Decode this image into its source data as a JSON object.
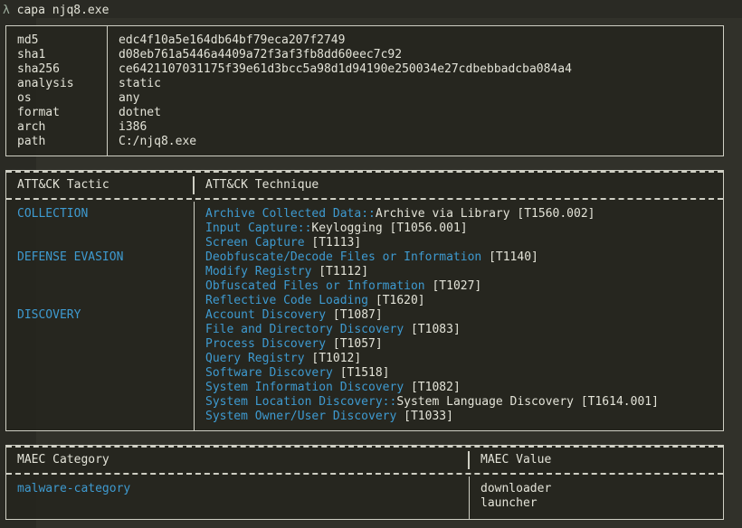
{
  "prompt": {
    "symbol": "λ",
    "command": "capa njq8.exe"
  },
  "info": {
    "rows": [
      {
        "key": "md5",
        "value": "edc4f10a5e164db64bf79eca207f2749"
      },
      {
        "key": "sha1",
        "value": "d08eb761a5446a4409a72f3af3fb8dd60eec7c92"
      },
      {
        "key": "sha256",
        "value": "ce6421107031175f39e61d3bcc5a98d1d94190e250034e27cdbebbadcba084a4"
      },
      {
        "key": "analysis",
        "value": "static"
      },
      {
        "key": "os",
        "value": "any"
      },
      {
        "key": "format",
        "value": "dotnet"
      },
      {
        "key": "arch",
        "value": "i386"
      },
      {
        "key": "path",
        "value": "C:/njq8.exe"
      }
    ]
  },
  "attack": {
    "header_tactic": "ATT&CK Tactic",
    "header_technique": "ATT&CK Technique",
    "tactics": [
      {
        "name": "COLLECTION",
        "row": 0
      },
      {
        "name": "DEFENSE EVASION",
        "row": 3
      },
      {
        "name": "DISCOVERY",
        "row": 7
      }
    ],
    "techniques": [
      {
        "tech": "Archive Collected Data",
        "sub": "Archive via Library",
        "id": "[T1560.002]"
      },
      {
        "tech": "Input Capture",
        "sub": "Keylogging",
        "id": "[T1056.001]"
      },
      {
        "tech": "Screen Capture",
        "sub": "",
        "id": "[T1113]"
      },
      {
        "tech": "Deobfuscate/Decode Files or Information",
        "sub": "",
        "id": "[T1140]"
      },
      {
        "tech": "Modify Registry",
        "sub": "",
        "id": "[T1112]"
      },
      {
        "tech": "Obfuscated Files or Information",
        "sub": "",
        "id": "[T1027]"
      },
      {
        "tech": "Reflective Code Loading",
        "sub": "",
        "id": "[T1620]"
      },
      {
        "tech": "Account Discovery",
        "sub": "",
        "id": "[T1087]"
      },
      {
        "tech": "File and Directory Discovery",
        "sub": "",
        "id": "[T1083]"
      },
      {
        "tech": "Process Discovery",
        "sub": "",
        "id": "[T1057]"
      },
      {
        "tech": "Query Registry",
        "sub": "",
        "id": "[T1012]"
      },
      {
        "tech": "Software Discovery",
        "sub": "",
        "id": "[T1518]"
      },
      {
        "tech": "System Information Discovery",
        "sub": "",
        "id": "[T1082]"
      },
      {
        "tech": "System Location Discovery",
        "sub": "System Language Discovery",
        "id": "[T1614.001]"
      },
      {
        "tech": "System Owner/User Discovery",
        "sub": "",
        "id": "[T1033]"
      }
    ]
  },
  "maec": {
    "header_category": "MAEC Category",
    "header_value": "MAEC Value",
    "category": "malware-category",
    "values": [
      "downloader",
      "launcher"
    ]
  },
  "colors": {
    "background": "#2a2a24",
    "text": "#e3e3d8",
    "accent": "#3e9ad0",
    "border": "#cfcfc4"
  }
}
